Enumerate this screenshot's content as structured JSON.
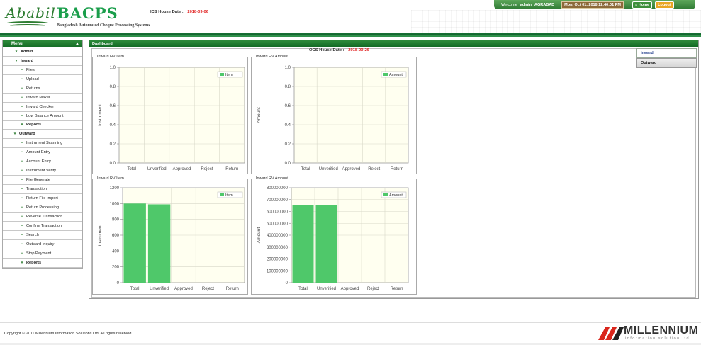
{
  "brand": {
    "script_name": "Ababil",
    "app_name": "BACPS",
    "subtitle": "Bangladesh Automated Cheque Processing Systems."
  },
  "topbar": {
    "welcome": "Welcome",
    "user": "admin",
    "branch": "AGRABAD",
    "datetime": "Mon, Oct 01, 2018 12:40:01 PM",
    "home": "Home",
    "logout": "Logout"
  },
  "sidebar": {
    "title": "Menu",
    "items": [
      {
        "label": "Admin",
        "level": "l0",
        "bullet": "▾"
      },
      {
        "label": "Inward",
        "level": "l0",
        "bullet": "▾"
      },
      {
        "label": "Files",
        "level": "l1",
        "bullet": "•"
      },
      {
        "label": "Upload",
        "level": "l1",
        "bullet": "•"
      },
      {
        "label": "Returns",
        "level": "l1",
        "bullet": "•"
      },
      {
        "label": "Inward Maker",
        "level": "l1",
        "bullet": "•"
      },
      {
        "label": "Inward Checker",
        "level": "l1",
        "bullet": "•"
      },
      {
        "label": "Low Balance Amount",
        "level": "l1",
        "bullet": "•"
      },
      {
        "label": "Reports",
        "level": "l1b",
        "bullet": "▾"
      },
      {
        "label": "Outward",
        "level": "l0h",
        "bullet": "▾"
      },
      {
        "label": "Instrument Scanning",
        "level": "l1",
        "bullet": "•"
      },
      {
        "label": "Amount Entry",
        "level": "l1",
        "bullet": "•"
      },
      {
        "label": "Account Entry",
        "level": "l1",
        "bullet": "•"
      },
      {
        "label": "Instrument Verify",
        "level": "l1",
        "bullet": "•"
      },
      {
        "label": "File Generate",
        "level": "l1",
        "bullet": "•"
      },
      {
        "label": "Transaction",
        "level": "l1",
        "bullet": "•"
      },
      {
        "label": "Return File Import",
        "level": "l1",
        "bullet": "•"
      },
      {
        "label": "Return Processing",
        "level": "l1",
        "bullet": "•"
      },
      {
        "label": "Reverse Transaction",
        "level": "l1",
        "bullet": "•"
      },
      {
        "label": "Confirm Transaction",
        "level": "l1",
        "bullet": "•"
      },
      {
        "label": "Search",
        "level": "l1",
        "bullet": "•"
      },
      {
        "label": "Outward Inquiry",
        "level": "l1",
        "bullet": "•"
      },
      {
        "label": "Stop Payment",
        "level": "l1",
        "bullet": "•"
      },
      {
        "label": "Reports",
        "level": "l1b",
        "bullet": "▾"
      }
    ]
  },
  "dashboard": {
    "title": "Dashboard",
    "ics_label": "ICS House Date :",
    "ics_date": "2018-09-06",
    "ocs_label": "OCS House Date :",
    "ocs_date": "2018-09-26"
  },
  "right_tabs": [
    "Inward",
    "Outward"
  ],
  "colors": {
    "bar": "#4fc86a",
    "plot_bg": "#fffff0",
    "accent": "#2d8a3a",
    "date_red": "#e02020"
  },
  "chart_data": [
    {
      "type": "bar",
      "panel_title": "Inward HV Item",
      "categories": [
        "Total",
        "Unverified",
        "Approved",
        "Reject",
        "Return"
      ],
      "series": [
        {
          "name": "Item",
          "values": [
            0,
            0,
            0,
            0,
            0
          ]
        }
      ],
      "ylabel": "Instrument",
      "ylim": [
        0.0,
        1.0
      ],
      "yticks": [
        "1.0",
        "0.8",
        "0.6",
        "0.4",
        "0.2",
        "0.0"
      ],
      "grid": true,
      "legend": "top-right"
    },
    {
      "type": "bar",
      "panel_title": "Inward HV Amount",
      "categories": [
        "Total",
        "Unverified",
        "Approved",
        "Reject",
        "Return"
      ],
      "series": [
        {
          "name": "Amount",
          "values": [
            0,
            0,
            0,
            0,
            0
          ]
        }
      ],
      "ylabel": "Amount",
      "ylim": [
        0.0,
        1.0
      ],
      "yticks": [
        "1.0",
        "0.8",
        "0.6",
        "0.4",
        "0.2",
        "0.0"
      ],
      "grid": true,
      "legend": "top-right"
    },
    {
      "type": "bar",
      "panel_title": "Inward RV Item",
      "categories": [
        "Total",
        "Unverified",
        "Approved",
        "Reject",
        "Return"
      ],
      "series": [
        {
          "name": "Item",
          "values": [
            1000,
            990,
            0,
            0,
            0
          ]
        }
      ],
      "ylabel": "Instrument",
      "ylim": [
        0,
        1200
      ],
      "yticks": [
        "1200",
        "1000",
        "800",
        "600",
        "400",
        "200",
        "0"
      ],
      "grid": true,
      "legend": "top-right"
    },
    {
      "type": "bar",
      "panel_title": "Inward RV Amount",
      "categories": [
        "Total",
        "Unverified",
        "Approved",
        "Reject",
        "Return"
      ],
      "series": [
        {
          "name": "Amount",
          "values": [
            655000000,
            652000000,
            0,
            0,
            0
          ]
        }
      ],
      "ylabel": "Amount",
      "ylim": [
        0,
        800000000
      ],
      "yticks": [
        "800000000",
        "700000000",
        "600000000",
        "500000000",
        "400000000",
        "300000000",
        "200000000",
        "100000000",
        "0"
      ],
      "grid": true,
      "legend": "top-right"
    }
  ],
  "footer": {
    "copyright": "Copyright © 2011 Millennium Information Solutions Ltd. All rights reserved.",
    "company": "MILLENNIUM",
    "company_sub": "information solution ltd."
  }
}
